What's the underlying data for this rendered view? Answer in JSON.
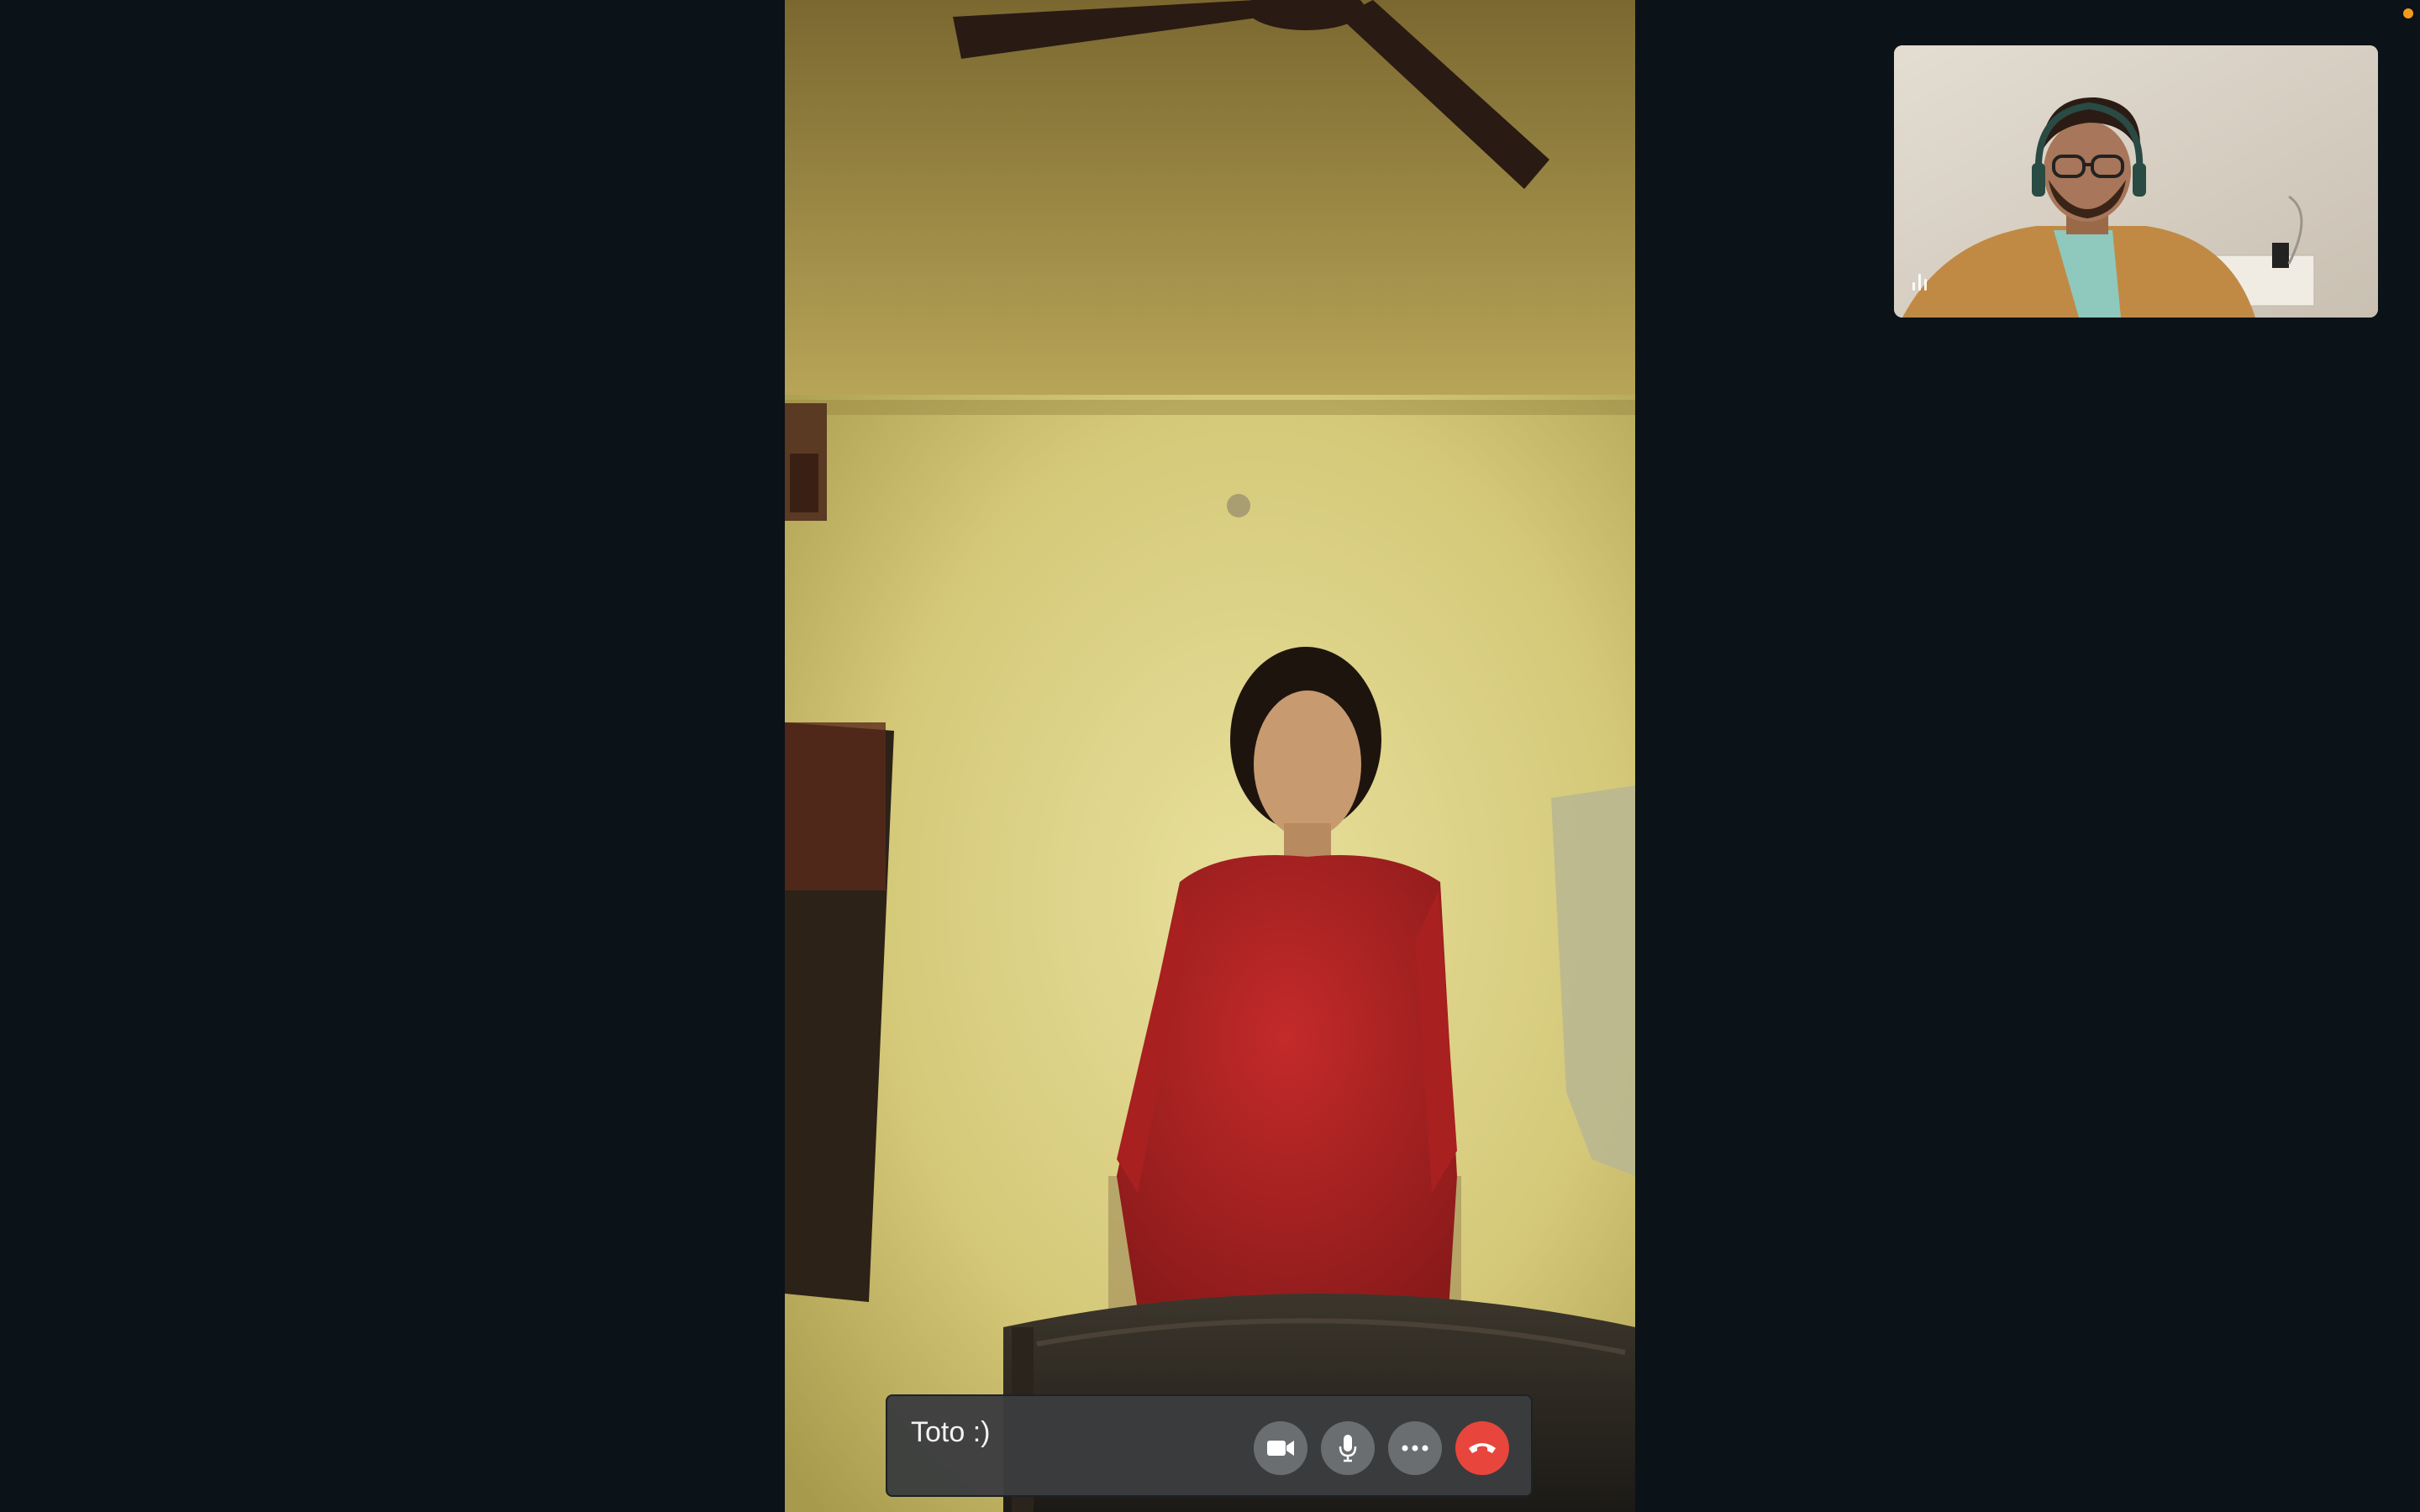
{
  "call": {
    "participant_name": "Toto :)"
  },
  "controls": [
    {
      "id": "camera",
      "icon": "video-camera-icon"
    },
    {
      "id": "microphone",
      "icon": "microphone-icon"
    },
    {
      "id": "more",
      "icon": "more-options-icon"
    },
    {
      "id": "hang_up",
      "icon": "phone-hangup-icon",
      "color": "#e8453c"
    }
  ],
  "colors": {
    "background": "#0b1218",
    "control_bar": "#3a3c3e",
    "button": "#6b6e71",
    "hang_up": "#e8453c",
    "recording_indicator": "#f29b1d"
  }
}
